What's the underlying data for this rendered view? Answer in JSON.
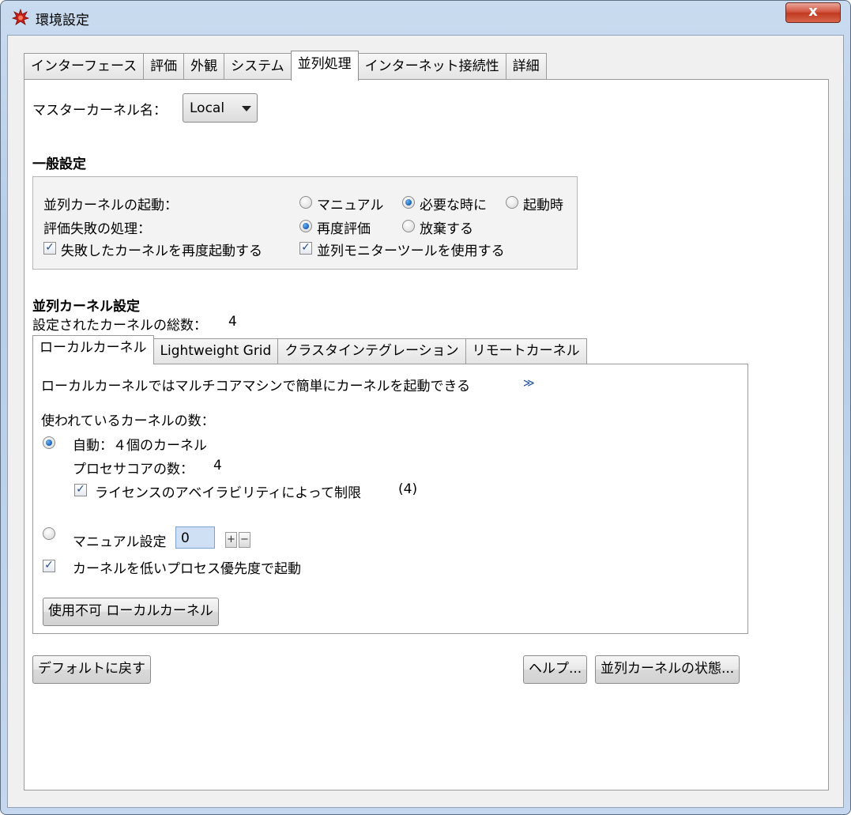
{
  "window": {
    "title": "環境設定",
    "close_glyph": "x"
  },
  "tabs": [
    "インターフェース",
    "評価",
    "外観",
    "システム",
    "並列処理",
    "インターネット接続性",
    "詳細"
  ],
  "active_tab": 4,
  "master_kernel": {
    "label": "マスターカーネル名：",
    "value": "Local"
  },
  "general": {
    "heading": "一般設定",
    "launch_label": "並列カーネルの起動：",
    "launch_options": [
      "マニュアル",
      "必要な時に",
      "起動時"
    ],
    "launch_selected": 1,
    "failure_label": "評価失敗の処理：",
    "failure_options": [
      "再度評価",
      "放棄する"
    ],
    "failure_selected": 0,
    "restart_failed_label": "失敗したカーネルを再度起動する",
    "restart_failed_checked": true,
    "use_monitor_label": "並列モニターツールを使用する",
    "use_monitor_checked": true
  },
  "kernel_settings": {
    "heading": "並列カーネル設定",
    "total_label": "設定されたカーネルの総数：",
    "total_value": "4"
  },
  "inner_tabs": [
    "ローカルカーネル",
    "Lightweight Grid",
    "クラスタインテグレーション",
    "リモートカーネル"
  ],
  "inner_active_tab": 0,
  "local": {
    "description": "ローカルカーネルではマルチコアマシンで簡単にカーネルを起動できる",
    "more_link": "≫",
    "count_label": "使われているカーネルの数：",
    "auto_label": "自動：４個のカーネル",
    "auto_selected": true,
    "cores_label": "プロセサコアの数：",
    "cores_value": "4",
    "license_label": "ライセンスのアベイラビリティによって制限",
    "license_value": "(4)",
    "license_checked": true,
    "manual_label": "マニュアル設定",
    "manual_selected": false,
    "manual_value": "0",
    "plus": "+",
    "minus": "−",
    "low_priority_label": "カーネルを低いプロセス優先度で起動",
    "low_priority_checked": true,
    "disable_button": "使用不可 ローカルカーネル"
  },
  "footer": {
    "reset_button": "デフォルトに戻す",
    "help_button": "ヘルプ...",
    "status_button": "並列カーネルの状態..."
  },
  "colors": {
    "accent": "#1b5fb5",
    "close_red": "#c0391f"
  }
}
